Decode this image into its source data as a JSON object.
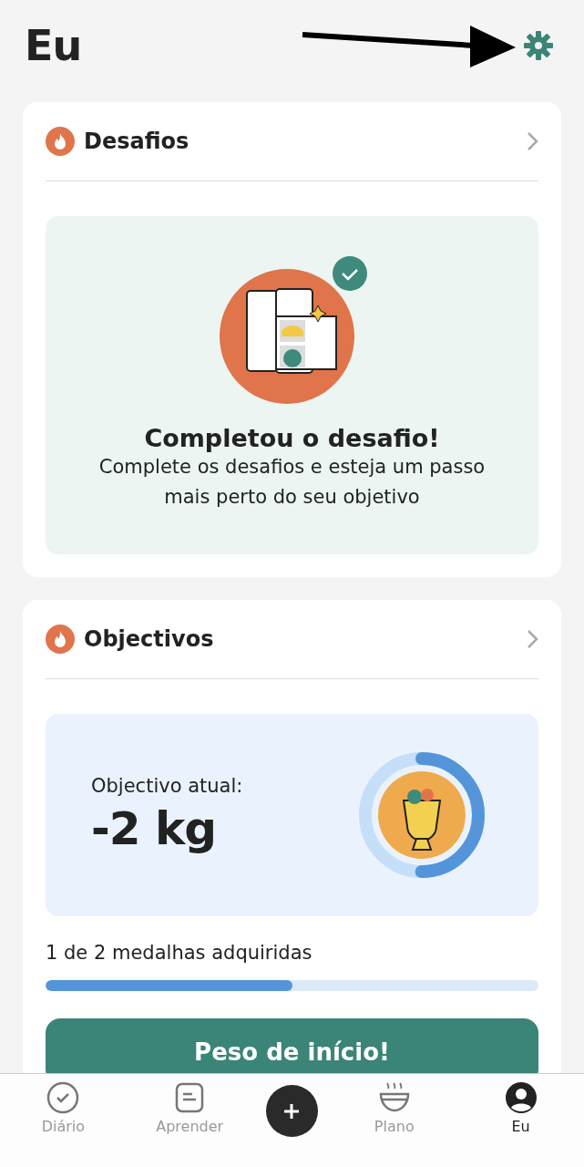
{
  "header": {
    "title": "Eu"
  },
  "challenges": {
    "title": "Desafios",
    "completed": true,
    "heading": "Completou o desafio!",
    "text": "Complete os desafios e esteja um passo mais perto do seu objetivo"
  },
  "goals": {
    "title": "Objectivos",
    "label": "Objectivo atual:",
    "value": "-2 kg",
    "ring": {
      "level": 0.5
    },
    "medals_text": "1 de 2 medalhas adquiridas",
    "medals": {
      "level": 0.5
    },
    "button": "Peso de início!"
  },
  "tabs": [
    {
      "kind": "item",
      "label": "Diário",
      "selected": false
    },
    {
      "kind": "item",
      "label": "Aprender",
      "selected": false
    },
    {
      "kind": "action"
    },
    {
      "kind": "item",
      "label": "Plano",
      "selected": false
    },
    {
      "kind": "item",
      "label": "Eu",
      "selected": true
    }
  ]
}
